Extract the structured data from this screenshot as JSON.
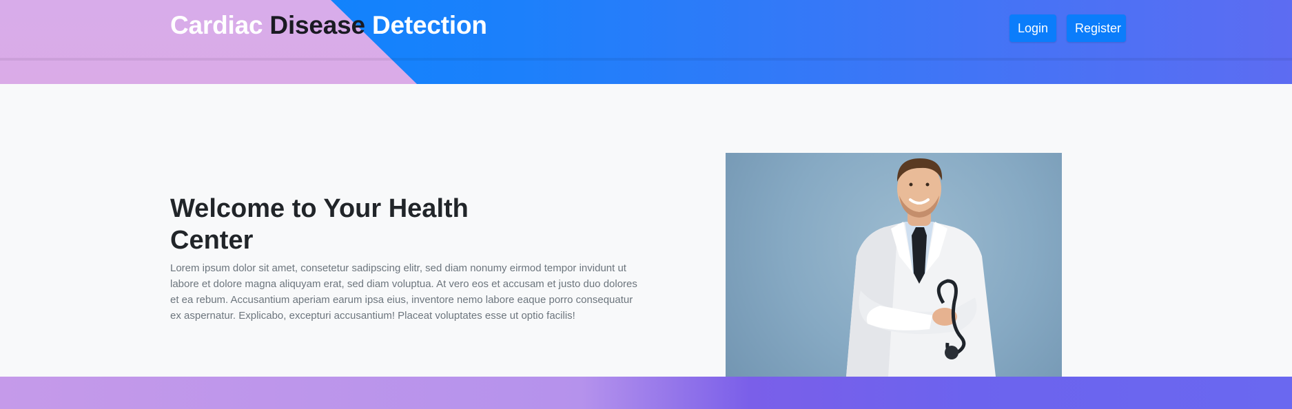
{
  "header": {
    "brand": {
      "part1": "Cardiac ",
      "part2": "Disease",
      "part3": " Detection"
    },
    "nav": {
      "login_label": "Login",
      "register_label": "Register"
    }
  },
  "hero": {
    "title": "Welcome to Your Health Center",
    "text": "Lorem ipsum dolor sit amet, consetetur sadipscing elitr, sed diam nonumy eirmod tempor invidunt ut labore et dolore magna aliquyam erat, sed diam voluptua. At vero eos et accusam et justo duo dolores et ea rebum. Accusantium aperiam earum ipsa eius, inventore nemo labore eaque porro consequatur ex aspernatur. Explicabo, excepturi accusantium! Placeat voluptates esse ut optio facilis!",
    "image": "doctor-with-stethoscope"
  },
  "colors": {
    "primary_button": "#0b7dfb",
    "header_blue": "#0088ff",
    "header_pink": "#d8acea",
    "footer_purple": "#6c63ee"
  }
}
